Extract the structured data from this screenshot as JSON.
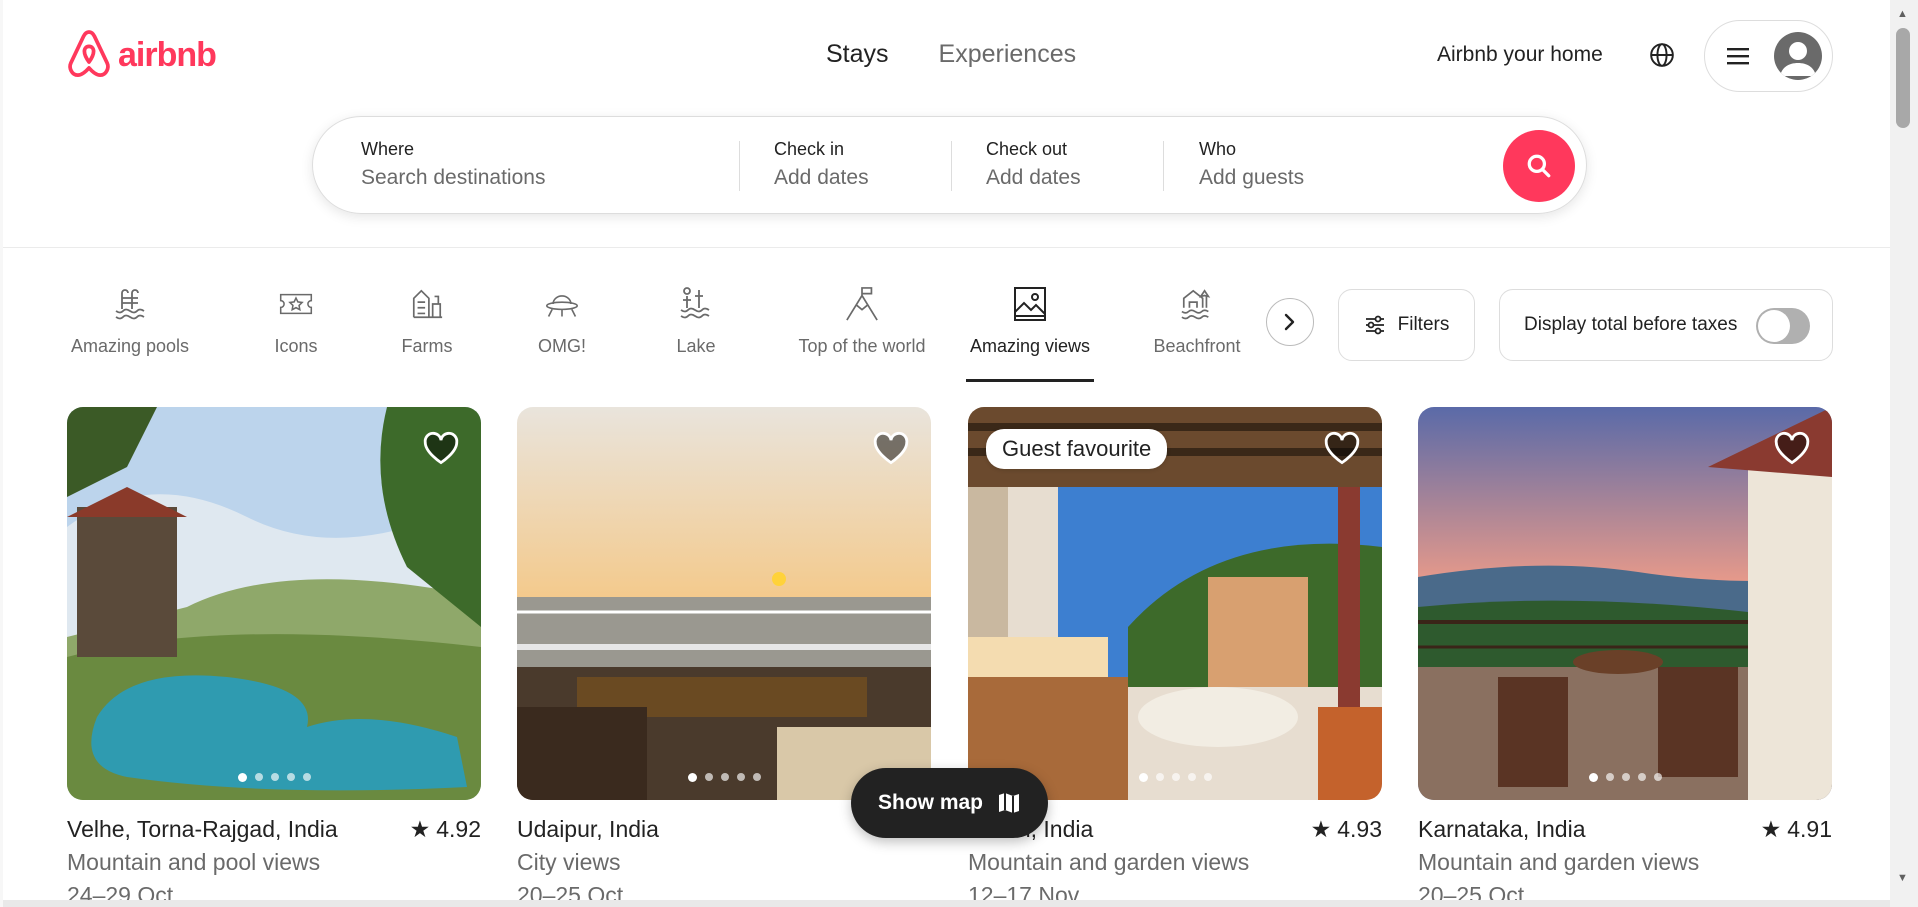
{
  "brand": {
    "name": "airbnb",
    "color": "#ff385c"
  },
  "nav": {
    "stays": "Stays",
    "experiences": "Experiences"
  },
  "header": {
    "host_link": "Airbnb your home"
  },
  "search": {
    "where_label": "Where",
    "where_placeholder": "Search destinations",
    "checkin_label": "Check in",
    "checkin_placeholder": "Add dates",
    "checkout_label": "Check out",
    "checkout_placeholder": "Add dates",
    "who_label": "Who",
    "who_placeholder": "Add guests"
  },
  "categories": [
    {
      "label": "Amazing pools",
      "icon": "pool-icon"
    },
    {
      "label": "Icons",
      "icon": "ticket-star-icon"
    },
    {
      "label": "Farms",
      "icon": "barn-icon"
    },
    {
      "label": "OMG!",
      "icon": "ufo-house-icon"
    },
    {
      "label": "Lake",
      "icon": "lake-icon"
    },
    {
      "label": "Top of the world",
      "icon": "summit-flag-icon"
    },
    {
      "label": "Amazing views",
      "icon": "framed-view-icon",
      "active": true
    },
    {
      "label": "Beachfront",
      "icon": "beachfront-icon"
    }
  ],
  "filters": {
    "label": "Filters"
  },
  "taxes": {
    "label": "Display total before taxes",
    "enabled": false
  },
  "listings": [
    {
      "location": "Velhe, Torna-Rajgad, India",
      "rating": "4.92",
      "subtitle": "Mountain and pool views",
      "dates": "24–29 Oct",
      "badge": ""
    },
    {
      "location": "Udaipur, India",
      "rating": "",
      "subtitle": "City views",
      "dates": "20–25 Oct",
      "badge": ""
    },
    {
      "location": "Siolim, India",
      "rating": "4.93",
      "subtitle": "Mountain and garden views",
      "dates": "12–17 Nov",
      "badge": "Guest favourite"
    },
    {
      "location": "Karnataka, India",
      "rating": "4.91",
      "subtitle": "Mountain and garden views",
      "dates": "20–25 Oct",
      "badge": ""
    }
  ],
  "show_map": {
    "label": "Show map"
  }
}
